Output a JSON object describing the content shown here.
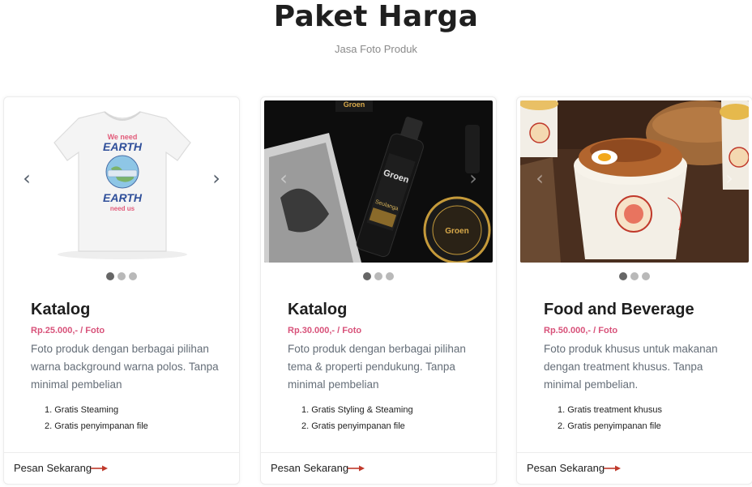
{
  "header": {
    "title": "Paket Harga",
    "subtitle": "Jasa Foto Produk"
  },
  "carousel": {
    "prev_glyph": "‹",
    "next_glyph": "›"
  },
  "cards": [
    {
      "title": "Katalog",
      "price": "Rp.25.000,- / Foto",
      "description": "Foto produk dengan berbagai pilihan warna background warna polos. Tanpa minimal pembelian",
      "features": [
        "1. Gratis Steaming",
        "2. Gratis penyimpanan file"
      ],
      "cta": "Pesan Sekarang",
      "image": {
        "shirt_text_1": "We need",
        "shirt_text_2": "EARTH",
        "shirt_text_3": "EARTH",
        "shirt_text_4": "need us"
      }
    },
    {
      "title": "Katalog",
      "price": "Rp.30.000,- / Foto",
      "description": "Foto produk dengan berbagai pilihan tema & properti pendukung. Tanpa minimal pembelian",
      "features": [
        "1. Gratis Styling & Steaming",
        "2. Gratis penyimpanan file"
      ],
      "cta": "Pesan Sekarang",
      "image": {
        "bottle_brand": "Groen",
        "bottle_sub": "Seulanga",
        "top_brand": "Groen",
        "jar_brand": "Groen"
      }
    },
    {
      "title": "Food and Beverage",
      "price": "Rp.50.000,- / Foto",
      "description": "Foto produk khusus untuk makanan dengan treatment khusus. Tanpa minimal pembelian.",
      "features": [
        "1. Gratis treatment khusus",
        "2. Gratis penyimpanan file"
      ],
      "cta": "Pesan Sekarang"
    }
  ],
  "colors": {
    "price": "#d8527a",
    "arrow": "#c0392b",
    "dot_active": "#666666",
    "dot_inactive": "#b9b9b9"
  }
}
